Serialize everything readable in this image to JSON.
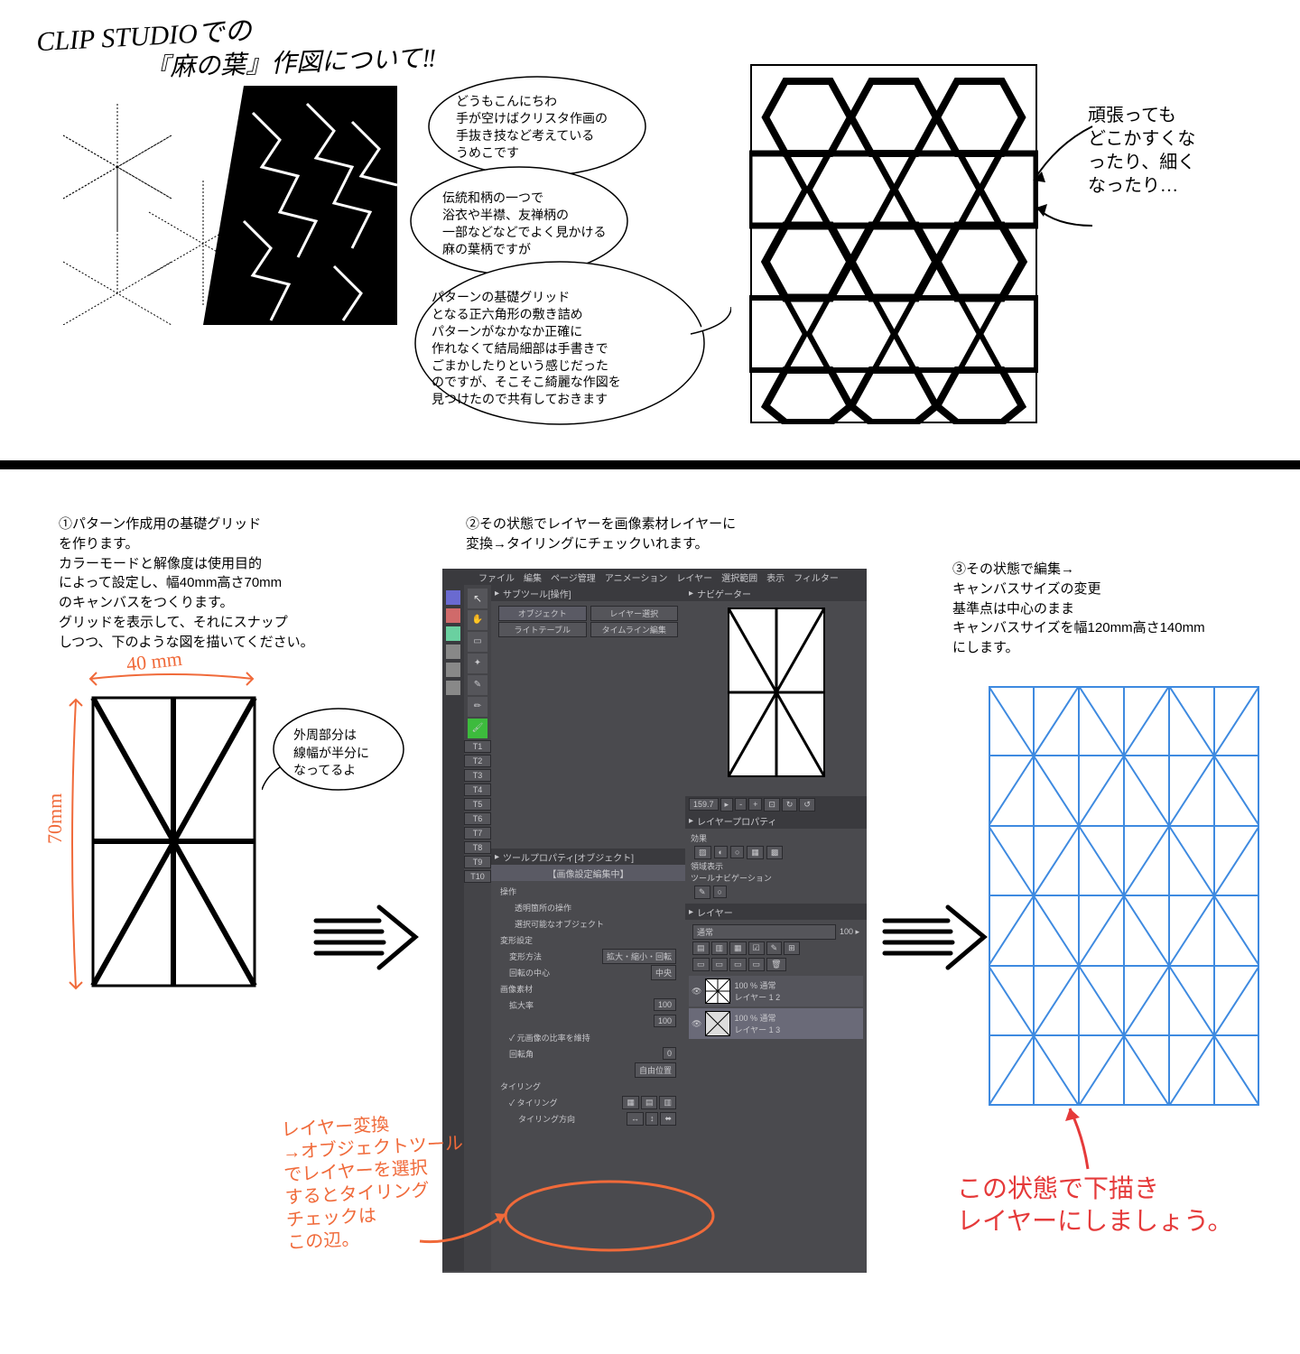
{
  "header": {
    "title_line1": "CLIP STUDIOでの",
    "title_line2": "『麻の葉』作図について‼"
  },
  "bubble1": "どうもこんにちわ\n手が空けばクリスタ作画の\n手抜き技など考えている\nうめこです",
  "bubble2": "伝統和柄の一つで\n浴衣や半襟、友禅柄の\n一部などなどでよく見かける\n麻の葉柄ですが",
  "bubble3": "パターンの基礎グリッド\nとなる正六角形の敷き詰め\nパターンがなかなか正確に\n作れなくて結局細部は手書きで\nごまかしたりという感じだった\nのですが、そこそこ綺麗な作図を\n見つけたので共有しておきます",
  "side_note_right": "頑張っても\nどこかすくな\nったり、細く\nなったり…",
  "step1": {
    "num": "①",
    "text": "パターン作成用の基礎グリッド\nを作ります。\nカラーモードと解像度は使用目的\nによって設定し、幅40mm高さ70mm\nのキャンバスをつくります。\nグリッドを表示して、それにスナップ\nしつつ、下のような図を描いてください。",
    "dim_w": "40 mm",
    "dim_h": "70mm",
    "outer_note": "外周部分は\n線幅が半分に\nなってるよ"
  },
  "step2": {
    "num": "②",
    "text": "その状態でレイヤーを画像素材レイヤーに\n変換→タイリングにチェックいれます。",
    "menu": [
      "ファイル",
      "編集",
      "ページ管理",
      "アニメーション",
      "レイヤー",
      "選択範囲",
      "表示",
      "フィルター"
    ],
    "panel_sub": "サブツール[操作]",
    "panel_obj": "オブジェクト",
    "panel_layersel": "レイヤー選択",
    "panel_light": "ライトテーブル",
    "panel_timeline": "タイムライン編集",
    "panel_nav": "ナビゲーター",
    "panel_toolprop": "ツールプロパティ[オブジェクト]",
    "panel_layerprop": "レイヤープロパティ",
    "panel_effect": "効果",
    "panel_area": "領域表示",
    "panel_nav2": "ツールナビゲーション",
    "panel_layer": "レイヤー",
    "panel_mode": "通常",
    "panel_op1": "操作",
    "panel_op1a": "透明箇所の操作",
    "panel_op1b": "選択可能なオブジェクト",
    "panel_trans": "変形設定",
    "panel_trans_method": "変形方法",
    "panel_trans_val": "拡大・縮小・回転",
    "panel_center": "回転の中心",
    "panel_center_val": "中央",
    "panel_img": "画像素材",
    "panel_scale": "拡大率",
    "panel_scale_val": "100",
    "panel_keep": "✓ 元画像の比率を維持",
    "panel_rot": "回転角",
    "panel_rot_val": "0",
    "panel_free": "自由位置",
    "panel_tile_h": "タイリング",
    "panel_tile": "✓ タイリング",
    "panel_tile_dir": "タイリング方向",
    "layer1": "100 % 通常\nレイヤー 1 2",
    "layer2": "100 % 通常\nレイヤー 1 3",
    "halo": "【画像設定編集中】",
    "hand_note": "レイヤー変換\n→オブジェクトツール\nでレイヤーを選択\nするとタイリング\nチェックは\nこの辺。"
  },
  "step3": {
    "num": "③",
    "text": "その状態で編集→\nキャンバスサイズの変更\n基準点は中心のまま\nキャンバスサイズを幅120mm高さ140mm\nにします。",
    "hand_note": "この状態で下描き\nレイヤーにしましょう。"
  },
  "toolbar_labels": [
    "T1",
    "T2",
    "T3",
    "T4",
    "T5",
    "T6",
    "T7",
    "T8",
    "T9",
    "T10"
  ]
}
